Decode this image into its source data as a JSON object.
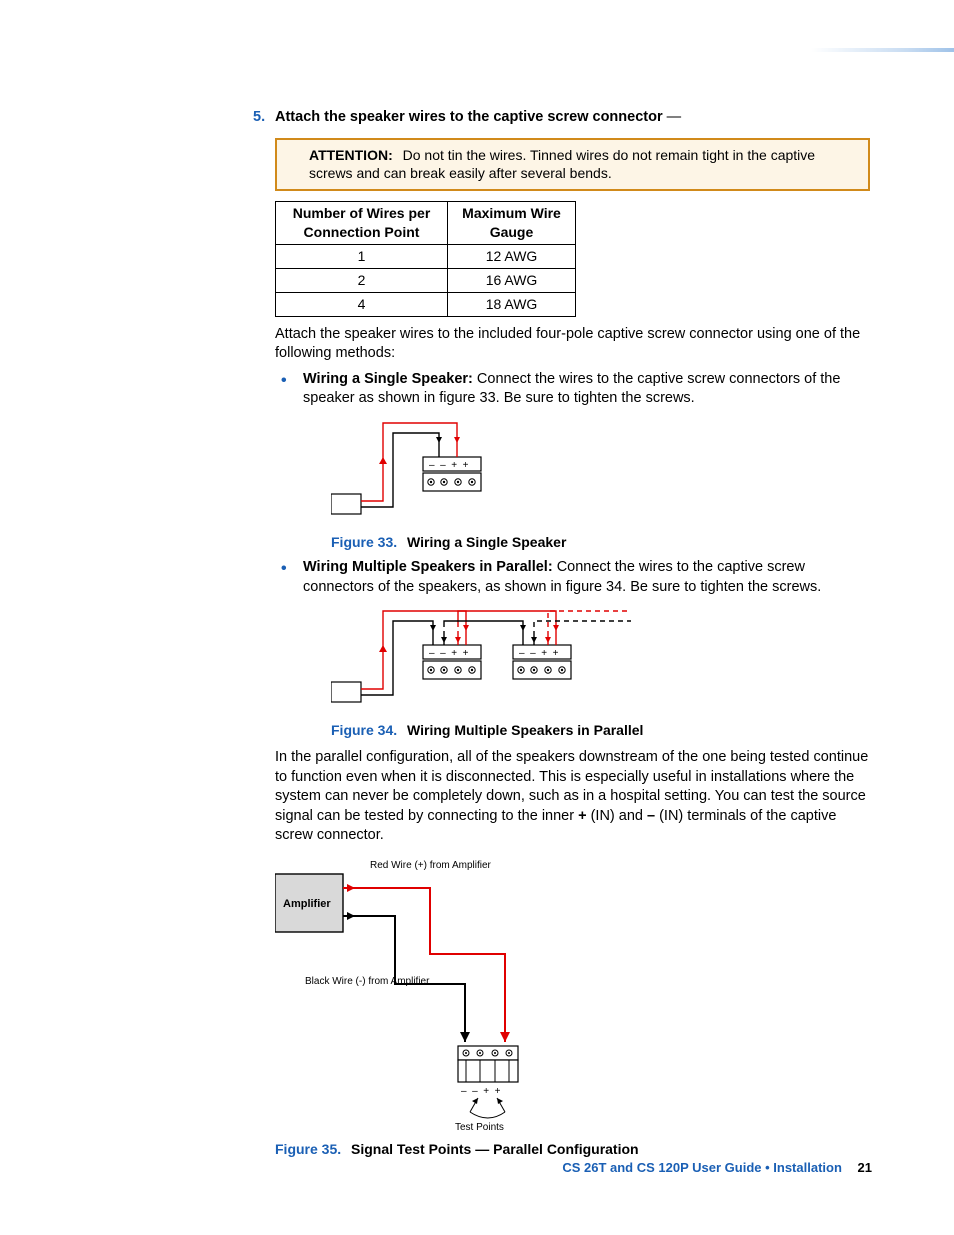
{
  "step": {
    "number": "5.",
    "title": "Attach the speaker wires to the captive screw connector",
    "dash": "—"
  },
  "callout": {
    "label": "ATTENTION:",
    "text": "Do not tin the wires. Tinned wires do not remain tight in the captive screws and can break easily after several bends."
  },
  "table": {
    "h1": "Number of Wires per Connection Point",
    "h2": "Maximum Wire Gauge",
    "rows": [
      {
        "a": "1",
        "b": "12 AWG"
      },
      {
        "a": "2",
        "b": "16 AWG"
      },
      {
        "a": "4",
        "b": "18 AWG"
      }
    ]
  },
  "para1": "Attach the speaker wires to the included four-pole captive screw connector using one of the following methods:",
  "bullet1": {
    "label": "Wiring a Single Speaker:",
    "text": " Connect the wires to the captive screw connectors of the speaker as shown in figure 33. Be sure to tighten the screws."
  },
  "fig33": {
    "label": "Figure 33.",
    "title": "Wiring a Single Speaker"
  },
  "bullet2": {
    "label": "Wiring Multiple Speakers in Parallel:",
    "text": " Connect the wires to the captive screw connectors of the speakers, as shown in figure 34. Be sure to tighten the screws."
  },
  "fig34": {
    "label": "Figure 34.",
    "title": "Wiring Multiple Speakers in Parallel"
  },
  "para2": {
    "t1": "In the parallel configuration, all of the speakers downstream of the one being tested continue to function even when it is disconnected. This is especially useful in installations where the system can never be completely down, such as in a hospital setting. You can test the source signal can be tested by connecting to the inner ",
    "b1": "+",
    "t2": " (IN) and ",
    "b2": "–",
    "t3": " (IN) terminals of the captive screw connector."
  },
  "fig35": {
    "amp": "Amplifier",
    "red": "Red Wire (+) from Amplifier",
    "black": "Black Wire (-) from Amplifier",
    "test": "Test Points",
    "label": "Figure 35.",
    "title": "Signal Test Points — Parallel Configuration"
  },
  "footer": {
    "text": "CS 26T and CS 120P User Guide • Installation",
    "page": "21"
  },
  "connector_marks": {
    "m1": "–",
    "m2": "–",
    "m3": "+",
    "m4": "+"
  }
}
